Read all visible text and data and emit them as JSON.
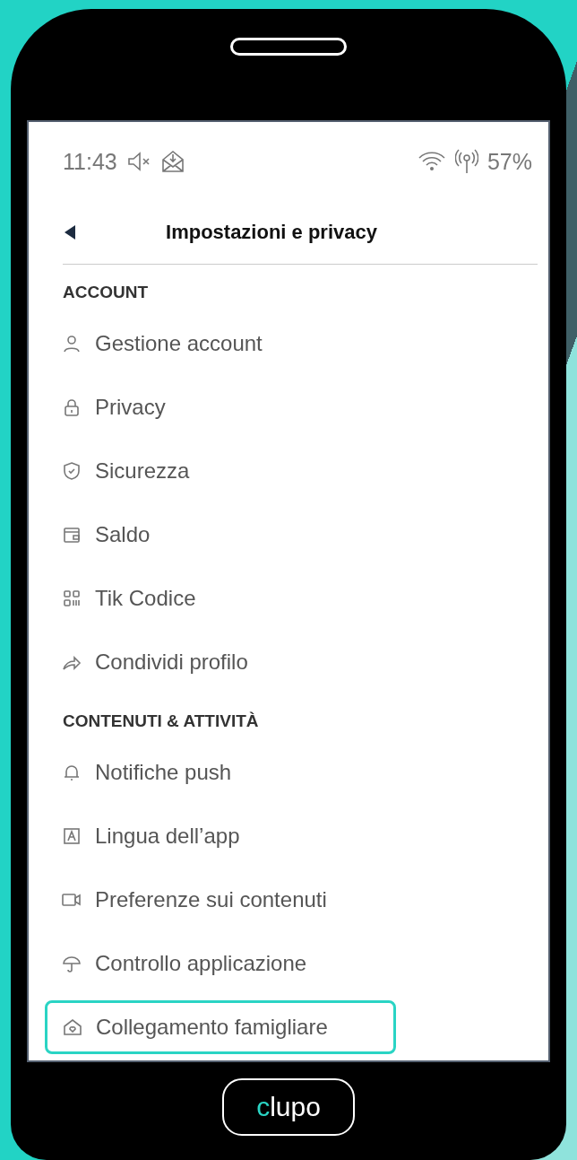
{
  "status_bar": {
    "time": "11:43",
    "battery": "57%"
  },
  "header": {
    "title": "Impostazioni e privacy"
  },
  "sections": [
    {
      "title": "ACCOUNT",
      "items": [
        {
          "label": "Gestione account",
          "kind": "user",
          "highlighted": false
        },
        {
          "label": "Privacy",
          "kind": "lock",
          "highlighted": false
        },
        {
          "label": "Sicurezza",
          "kind": "shield",
          "highlighted": false
        },
        {
          "label": "Saldo",
          "kind": "wallet",
          "highlighted": false
        },
        {
          "label": "Tik Codice",
          "kind": "qr",
          "highlighted": false
        },
        {
          "label": "Condividi profilo",
          "kind": "share",
          "highlighted": false
        }
      ]
    },
    {
      "title": "CONTENUTI & ATTIVITÀ",
      "items": [
        {
          "label": "Notifiche push",
          "kind": "bell",
          "highlighted": false
        },
        {
          "label": "Lingua dell’app",
          "kind": "letter",
          "highlighted": false
        },
        {
          "label": "Preferenze sui contenuti",
          "kind": "video",
          "highlighted": false
        },
        {
          "label": "Controllo applicazione",
          "kind": "umbrella",
          "highlighted": false
        },
        {
          "label": "Collegamento famigliare",
          "kind": "house",
          "highlighted": true
        }
      ]
    }
  ],
  "home_button": {
    "accent": "c",
    "rest": "lupo"
  }
}
